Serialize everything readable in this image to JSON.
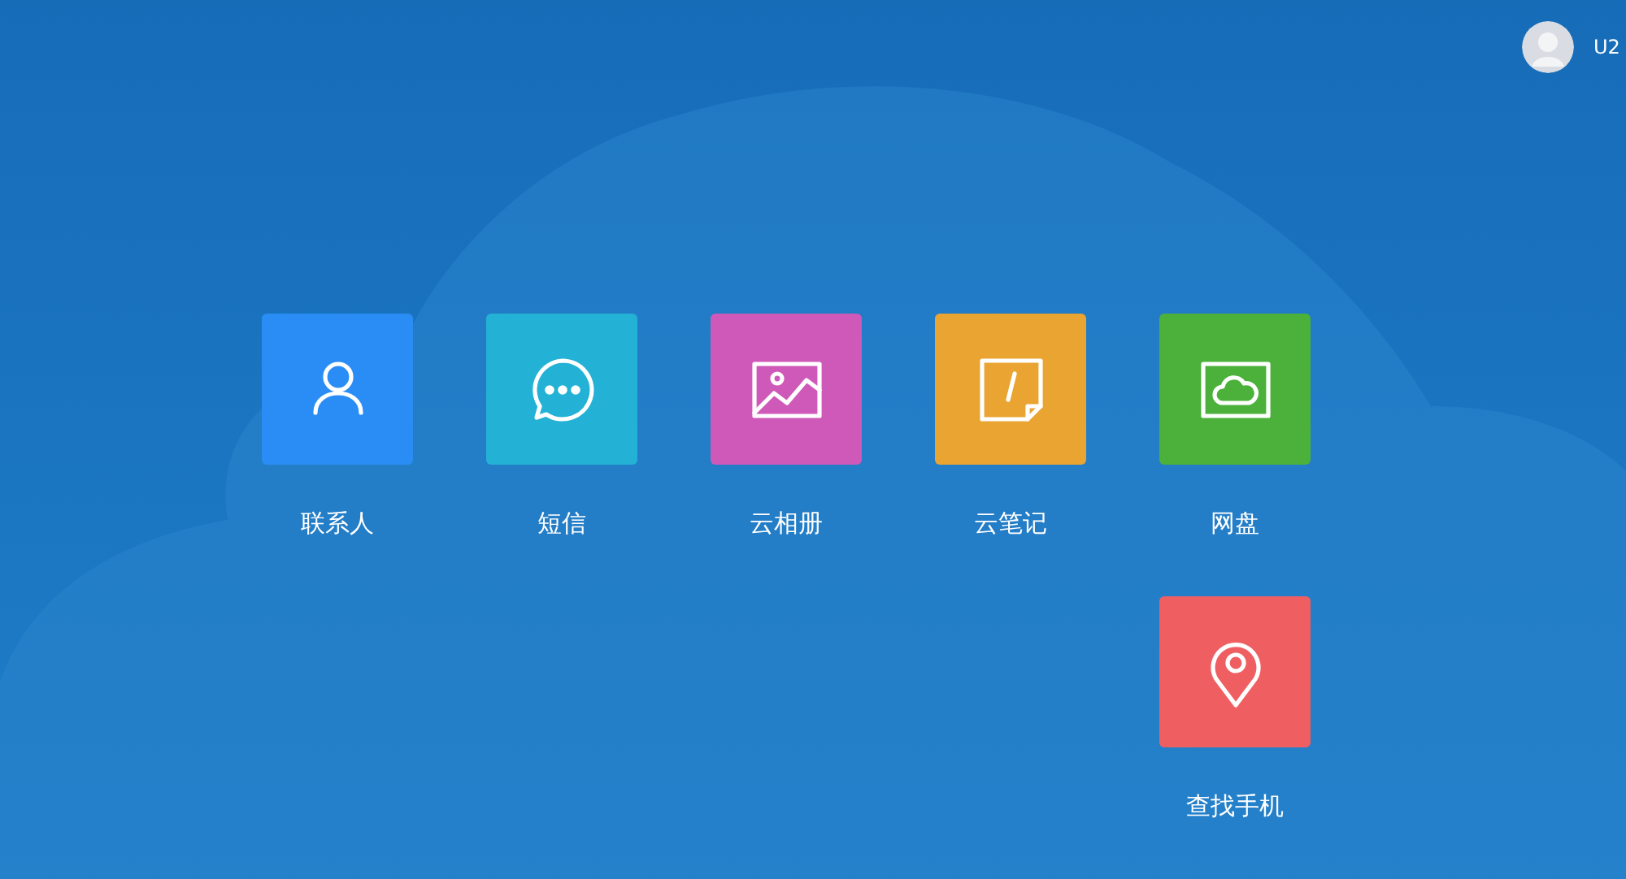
{
  "user": {
    "name": "U2"
  },
  "apps": [
    {
      "label": "联系人",
      "kind": "contacts",
      "color": "#2a8df5"
    },
    {
      "label": "短信",
      "kind": "messages",
      "color": "#23b2d6"
    },
    {
      "label": "云相册",
      "kind": "photos",
      "color": "#cf59b9"
    },
    {
      "label": "云笔记",
      "kind": "notes",
      "color": "#e9a431"
    },
    {
      "label": "网盘",
      "kind": "drive",
      "color": "#4bb13b"
    },
    {
      "label": "查找手机",
      "kind": "find",
      "color": "#ef5f62"
    }
  ]
}
